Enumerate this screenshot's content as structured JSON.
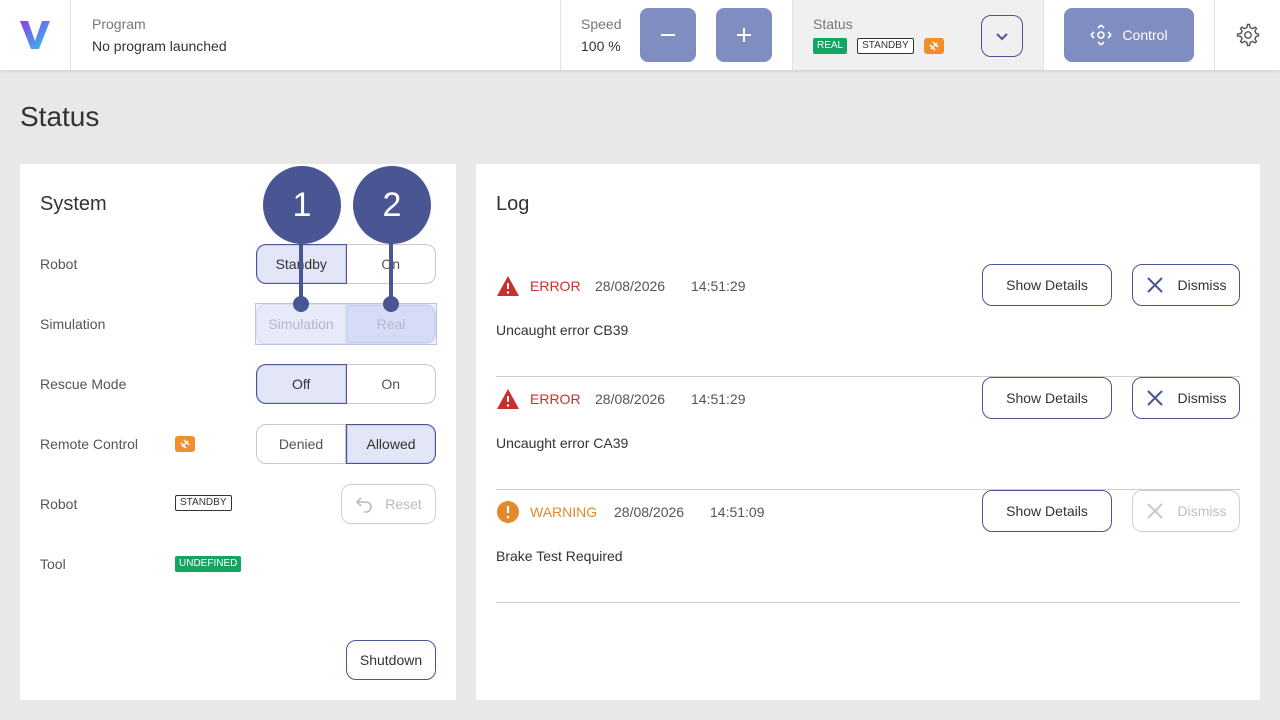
{
  "header": {
    "program_label": "Program",
    "program_value": "No program launched",
    "speed_label": "Speed",
    "speed_value": "100 %",
    "status_label": "Status",
    "status_badges": [
      "REAL",
      "STANDBY"
    ],
    "control_label": "Control"
  },
  "page_title": "Status",
  "system": {
    "title": "System",
    "rows": [
      {
        "label": "Robot",
        "options": [
          "Standby",
          "On"
        ],
        "selected": 0
      },
      {
        "label": "Simulation",
        "options": [
          "Simulation",
          "Real"
        ],
        "selected": 1,
        "disabled": true
      },
      {
        "label": "Rescue Mode",
        "options": [
          "Off",
          "On"
        ],
        "selected": 0
      },
      {
        "label": "Remote Control",
        "options": [
          "Denied",
          "Allowed"
        ],
        "selected": 1
      },
      {
        "label": "Robot",
        "badge": "STANDBY",
        "action": "Reset"
      },
      {
        "label": "Tool",
        "badge": "UNDEFINED"
      }
    ],
    "shutdown_label": "Shutdown"
  },
  "callouts": [
    "1",
    "2"
  ],
  "log": {
    "title": "Log",
    "show_details_label": "Show Details",
    "dismiss_label": "Dismiss",
    "entries": [
      {
        "level": "ERROR",
        "date": "28/08/2026",
        "time": "14:51:29",
        "message": "Uncaught error CB39"
      },
      {
        "level": "ERROR",
        "date": "28/08/2026",
        "time": "14:51:29",
        "message": "Uncaught error CA39"
      },
      {
        "level": "WARNING",
        "date": "28/08/2026",
        "time": "14:51:09",
        "message": "Brake Test Required"
      }
    ]
  },
  "colors": {
    "accent": "#4a5593",
    "button_fill": "#7f8dc1",
    "error": "#c8312b",
    "warning": "#e38a2a",
    "success": "#13a562",
    "orange_icon": "#ef8f2e"
  }
}
